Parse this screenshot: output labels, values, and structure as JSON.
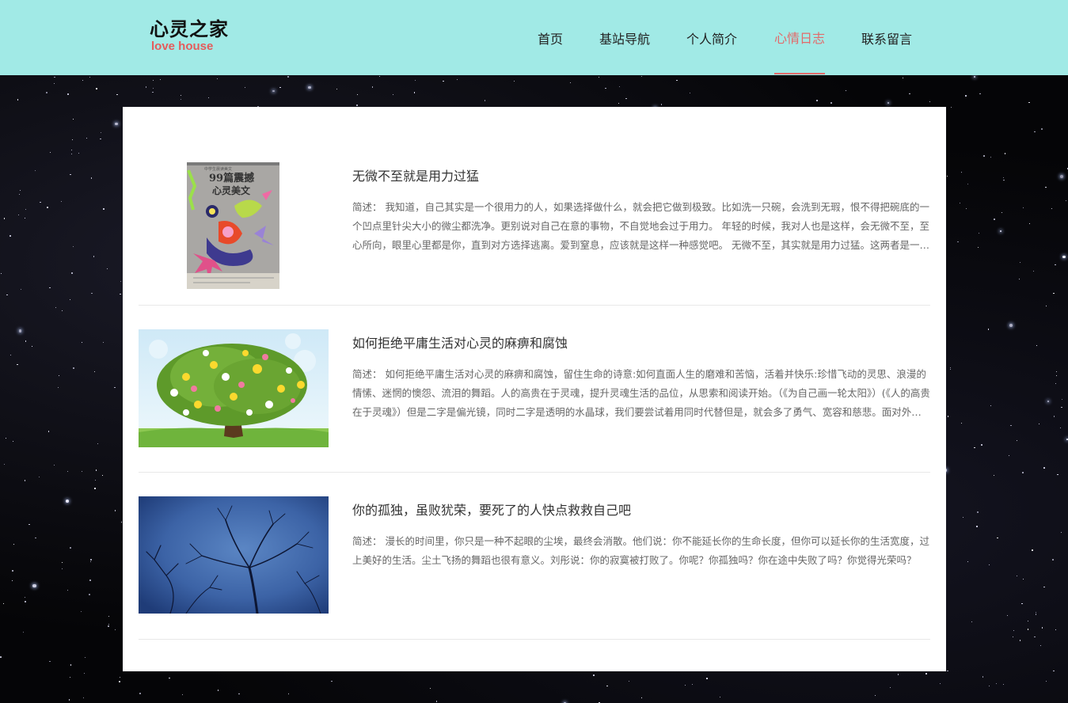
{
  "logo": {
    "cn": "心灵之家",
    "en": "love house"
  },
  "nav": {
    "items": [
      "首页",
      "基站导航",
      "个人简介",
      "心情日志",
      "联系留言"
    ],
    "active_index": 3
  },
  "colors": {
    "header_bg": "#a1eae6",
    "accent": "#e36a6a"
  },
  "articles": [
    {
      "title": "无微不至就是用力过猛",
      "desc": "简述：  我知道，自己其实是一个很用力的人，如果选择做什么，就会把它做到极致。比如洗一只碗，会洗到无瑕，恨不得把碗底的一个凹点里针尖大小的微尘都洗净。更别说对自己在意的事物，不自觉地会过于用力。  年轻的时候，我对人也是这样，会无微不至，至心所向，眼里心里都是你，直到对方选择逃离。爱到窒息，应该就是这样一种感觉吧。  无微不至，其实就是用力过猛。这两者是一个意思。  在情感中，我们往往也是如此……",
      "image": "book-cover",
      "cover_text": [
        "99篇震撼",
        "心灵美文"
      ]
    },
    {
      "title": "如何拒绝平庸生活对心灵的麻痹和腐蚀",
      "desc": "简述：  如何拒绝平庸生活对心灵的麻痹和腐蚀，留住生命的诗意:如何直面人生的磨难和苦恼，活着并快乐:珍惜飞动的灵思、浪漫的情愫、迷惘的懊怨、流泪的舞蹈。人的高贵在于灵魂，提升灵魂生活的品位，从思索和阅读开始。（《为自己画一轮太阳》）(《人的高贵在于灵魂》）但是二字是偏光镜，同时二字是透明的水晶球，我们要尝试着用同时代替但是，就会多了勇气、宽容和慈悲。面对外国教授的……",
      "image": "flower-tree"
    },
    {
      "title": "你的孤独，虽败犹荣，要死了的人快点救救自己吧",
      "desc": "简述：  漫长的时间里，你只是一种不起眼的尘埃，最终会消散。他们说：你不能延长你的生命长度，但你可以延长你的生活宽度，过上美好的生活。尘土飞扬的舞蹈也很有意义。刘彤说：你的寂寞被打败了。你呢？你孤独吗？你在途中失败了吗？你觉得光荣吗？",
      "image": "blue-sky-branches"
    }
  ]
}
